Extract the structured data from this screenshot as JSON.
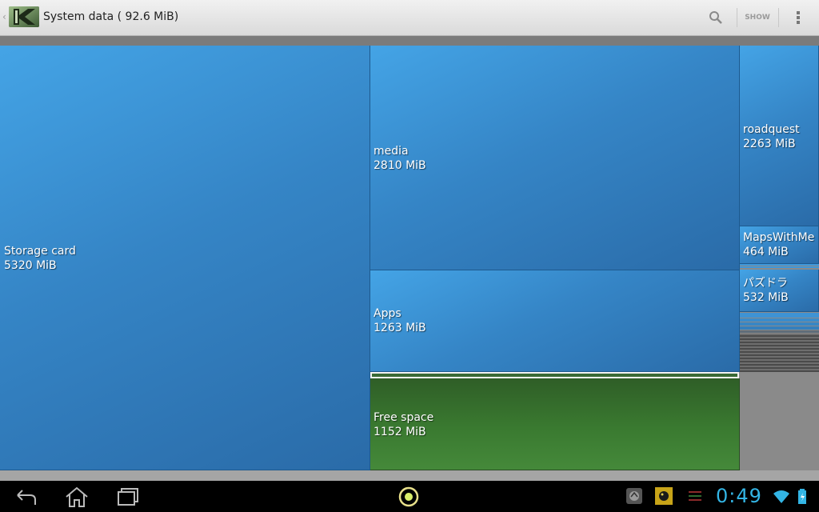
{
  "header": {
    "title": "System data ( 92.6 MiB)",
    "show_label": "SHOW",
    "icons": [
      "up-caret-icon",
      "app-logo-icon",
      "search-icon",
      "overflow-menu-icon"
    ]
  },
  "treemap": {
    "tiles": [
      {
        "name": "Storage card",
        "size": "5320 MiB"
      },
      {
        "name": "media",
        "size": "2810 MiB"
      },
      {
        "name": "Apps",
        "size": "1263 MiB"
      },
      {
        "name": "Free space",
        "size": "1152 MiB"
      },
      {
        "name": "roadquest",
        "size": "2263 MiB"
      },
      {
        "name": "MapsWithMe",
        "size": "464 MiB"
      },
      {
        "name": "パズドラ",
        "size": "532 MiB"
      }
    ],
    "colors": {
      "folder": "#3a8fd4",
      "free": "#3a7a30",
      "background": "#8a8a8a"
    }
  },
  "navbar": {
    "clock": "0:49",
    "icons": [
      "back-icon",
      "home-icon",
      "recent-apps-icon",
      "launcher-icon",
      "notification-app-icon",
      "notification-game-icon",
      "notification-signal-icon",
      "wifi-icon",
      "battery-icon"
    ],
    "accent": "#33b5e5"
  }
}
